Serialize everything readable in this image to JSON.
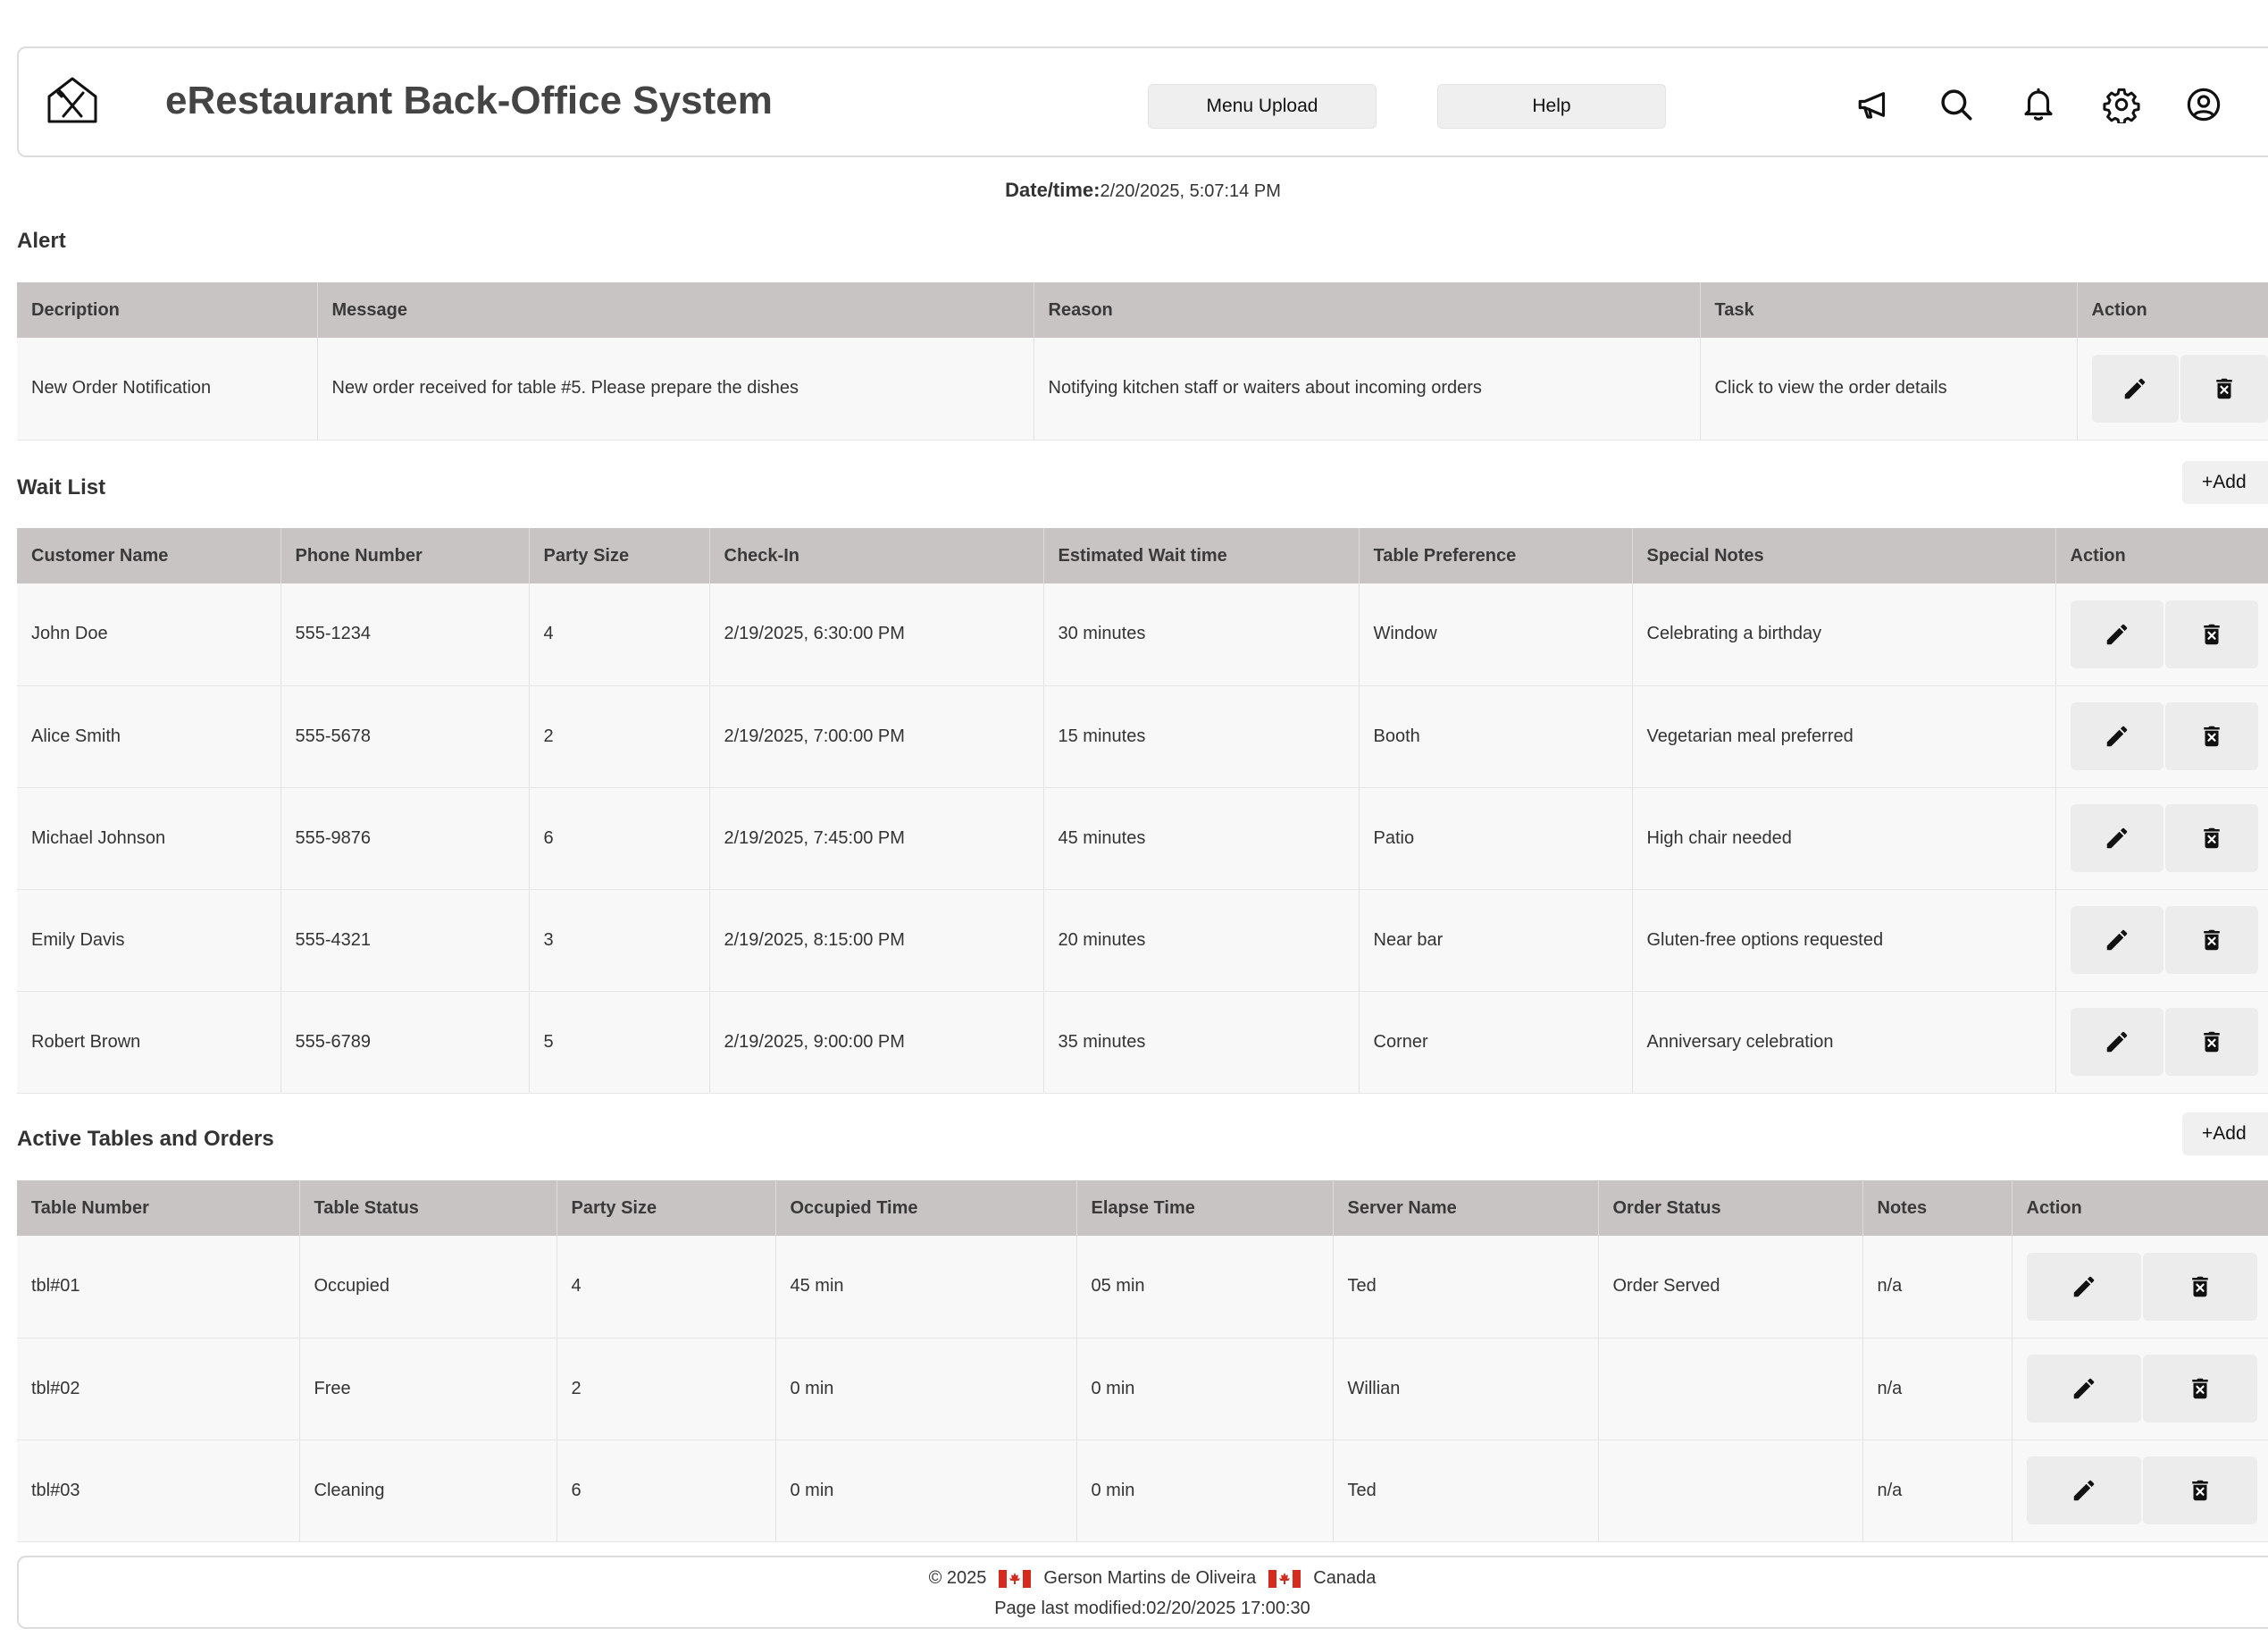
{
  "header": {
    "title": "eRestaurant Back-Office System",
    "buttons": {
      "menu_upload": "Menu Upload",
      "help": "Help"
    },
    "icons": [
      "megaphone-icon",
      "search-icon",
      "bell-icon",
      "gear-icon",
      "user-icon"
    ]
  },
  "datetime": {
    "label": "Date/time:",
    "value": "2/20/2025, 5:07:14 PM"
  },
  "alert": {
    "title": "Alert",
    "columns": [
      "Decription",
      "Message",
      "Reason",
      "Task",
      "Action"
    ],
    "rows": [
      [
        "New Order Notification",
        "New order received for table #5. Please prepare the dishes",
        "Notifying kitchen staff or waiters about incoming orders",
        "Click to view the order details"
      ]
    ]
  },
  "waitlist": {
    "title": "Wait List",
    "add_label": "+Add",
    "columns": [
      "Customer Name",
      "Phone Number",
      "Party Size",
      "Check-In",
      "Estimated Wait time",
      "Table Preference",
      "Special Notes",
      "Action"
    ],
    "rows": [
      [
        "John Doe",
        "555-1234",
        "4",
        "2/19/2025, 6:30:00 PM",
        "30 minutes",
        "Window",
        "Celebrating a birthday"
      ],
      [
        "Alice Smith",
        "555-5678",
        "2",
        "2/19/2025, 7:00:00 PM",
        "15 minutes",
        "Booth",
        "Vegetarian meal preferred"
      ],
      [
        "Michael Johnson",
        "555-9876",
        "6",
        "2/19/2025, 7:45:00 PM",
        "45 minutes",
        "Patio",
        "High chair needed"
      ],
      [
        "Emily Davis",
        "555-4321",
        "3",
        "2/19/2025, 8:15:00 PM",
        "20 minutes",
        "Near bar",
        "Gluten-free options requested"
      ],
      [
        "Robert Brown",
        "555-6789",
        "5",
        "2/19/2025, 9:00:00 PM",
        "35 minutes",
        "Corner",
        "Anniversary celebration"
      ]
    ]
  },
  "tables": {
    "title": "Active Tables and Orders",
    "add_label": "+Add",
    "columns": [
      "Table Number",
      "Table Status",
      "Party Size",
      "Occupied Time",
      "Elapse Time",
      "Server Name",
      "Order Status",
      "Notes",
      "Action"
    ],
    "rows": [
      [
        "tbl#01",
        "Occupied",
        "4",
        "45 min",
        "05 min",
        "Ted",
        "Order Served",
        "n/a"
      ],
      [
        "tbl#02",
        "Free",
        "2",
        "0 min",
        "0 min",
        "Willian",
        "",
        "n/a"
      ],
      [
        "tbl#03",
        "Cleaning",
        "6",
        "0 min",
        "0 min",
        "Ted",
        "",
        "n/a"
      ]
    ]
  },
  "footer": {
    "copyright": "© 2025",
    "author": "Gerson Martins de Oliveira",
    "country": "Canada",
    "last_modified": "Page last modified:02/20/2025 17:00:30"
  },
  "colors": {
    "header_row": "#c8c4c3",
    "row_bg": "#f8f8f8",
    "button_bg": "#ececec",
    "flag_red": "#d52b1e"
  }
}
